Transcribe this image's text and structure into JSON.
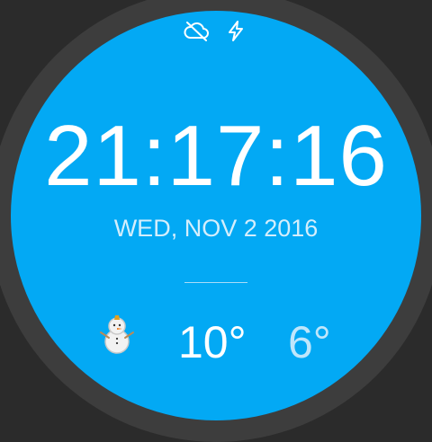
{
  "status": {
    "icons": [
      "cloud-off-icon",
      "charging-bolt-icon"
    ]
  },
  "clock": {
    "time": "21:17:16",
    "date": "WED, NOV 2 2016"
  },
  "weather": {
    "icon": "snowman-icon",
    "temp_high": "10°",
    "temp_low": "6°"
  },
  "colors": {
    "face": "#03A9F4",
    "bezel": "#3d3d3d",
    "background": "#2b2b2b"
  }
}
